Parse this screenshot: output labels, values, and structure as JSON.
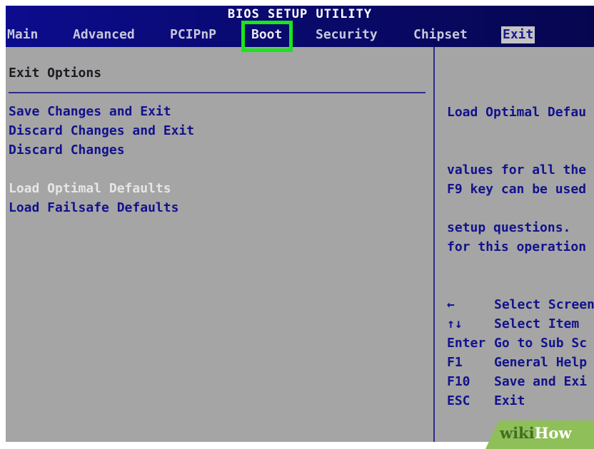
{
  "header": {
    "title": "BIOS SETUP UTILITY",
    "tabs": [
      {
        "label": "Main"
      },
      {
        "label": "Advanced"
      },
      {
        "label": "PCIPnP"
      },
      {
        "label": "Boot"
      },
      {
        "label": "Security"
      },
      {
        "label": "Chipset"
      },
      {
        "label": "Exit"
      }
    ],
    "active_tab": "Exit",
    "highlighted_tab": "Boot"
  },
  "main": {
    "section_title": "Exit Options",
    "options": [
      {
        "label": "Save Changes and Exit"
      },
      {
        "label": "Discard Changes and Exit"
      },
      {
        "label": "Discard Changes"
      },
      {
        "label": "Load Optimal Defaults"
      },
      {
        "label": "Load Failsafe Defaults"
      }
    ],
    "selected_option": "Load Optimal Defaults"
  },
  "help": {
    "lines": [
      "Load Optimal Defau",
      "values for all the",
      "setup questions."
    ],
    "lines2": [
      "F9 key can be used",
      "for this operation"
    ]
  },
  "keys": [
    {
      "key": "←",
      "desc": "Select Screen"
    },
    {
      "key": "↑↓",
      "desc": "Select Item"
    },
    {
      "key": "Enter",
      "desc": "Go to Sub Sc"
    },
    {
      "key": "F1",
      "desc": "General Help"
    },
    {
      "key": "F10",
      "desc": "Save and Exi"
    },
    {
      "key": "ESC",
      "desc": "Exit"
    }
  ],
  "watermark": {
    "part1": "wiki",
    "part2": "How"
  },
  "colors": {
    "background": "#a5a5a5",
    "header_blue": "#0a0a72",
    "text_blue": "#12128c",
    "highlight_green": "#19e619"
  }
}
